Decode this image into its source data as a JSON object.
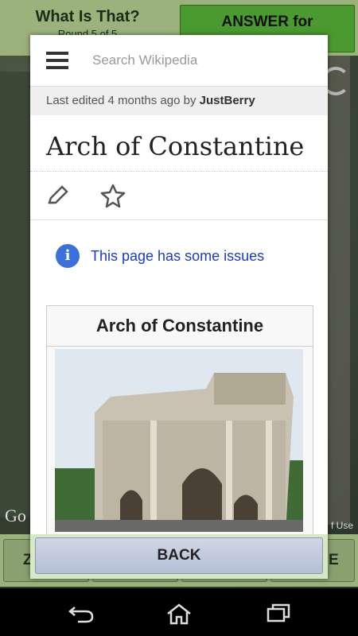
{
  "game": {
    "title": "What Is That?",
    "round": "Round 5 of 5",
    "answer_label": "ANSWER for",
    "google_mark": "Go",
    "terms_mark": "f Use",
    "choices": [
      "Z",
      "",
      "",
      "E"
    ]
  },
  "wiki": {
    "search_placeholder": "Search Wikipedia",
    "last_edited_prefix": "Last edited 4 months ago by ",
    "last_edited_user": "JustBerry",
    "page_title": "Arch of Constantine",
    "issues_text": "This page has some issues",
    "infobox_title": "Arch of Constantine"
  },
  "back_label": "BACK",
  "colors": {
    "accent": "#4b9a2f",
    "link": "#1a3bbf",
    "info": "#3b6fd9"
  },
  "icons": [
    "menu-icon",
    "pencil-icon",
    "star-icon",
    "info-icon",
    "refresh-icon",
    "back-nav-icon",
    "home-nav-icon",
    "recents-nav-icon"
  ]
}
